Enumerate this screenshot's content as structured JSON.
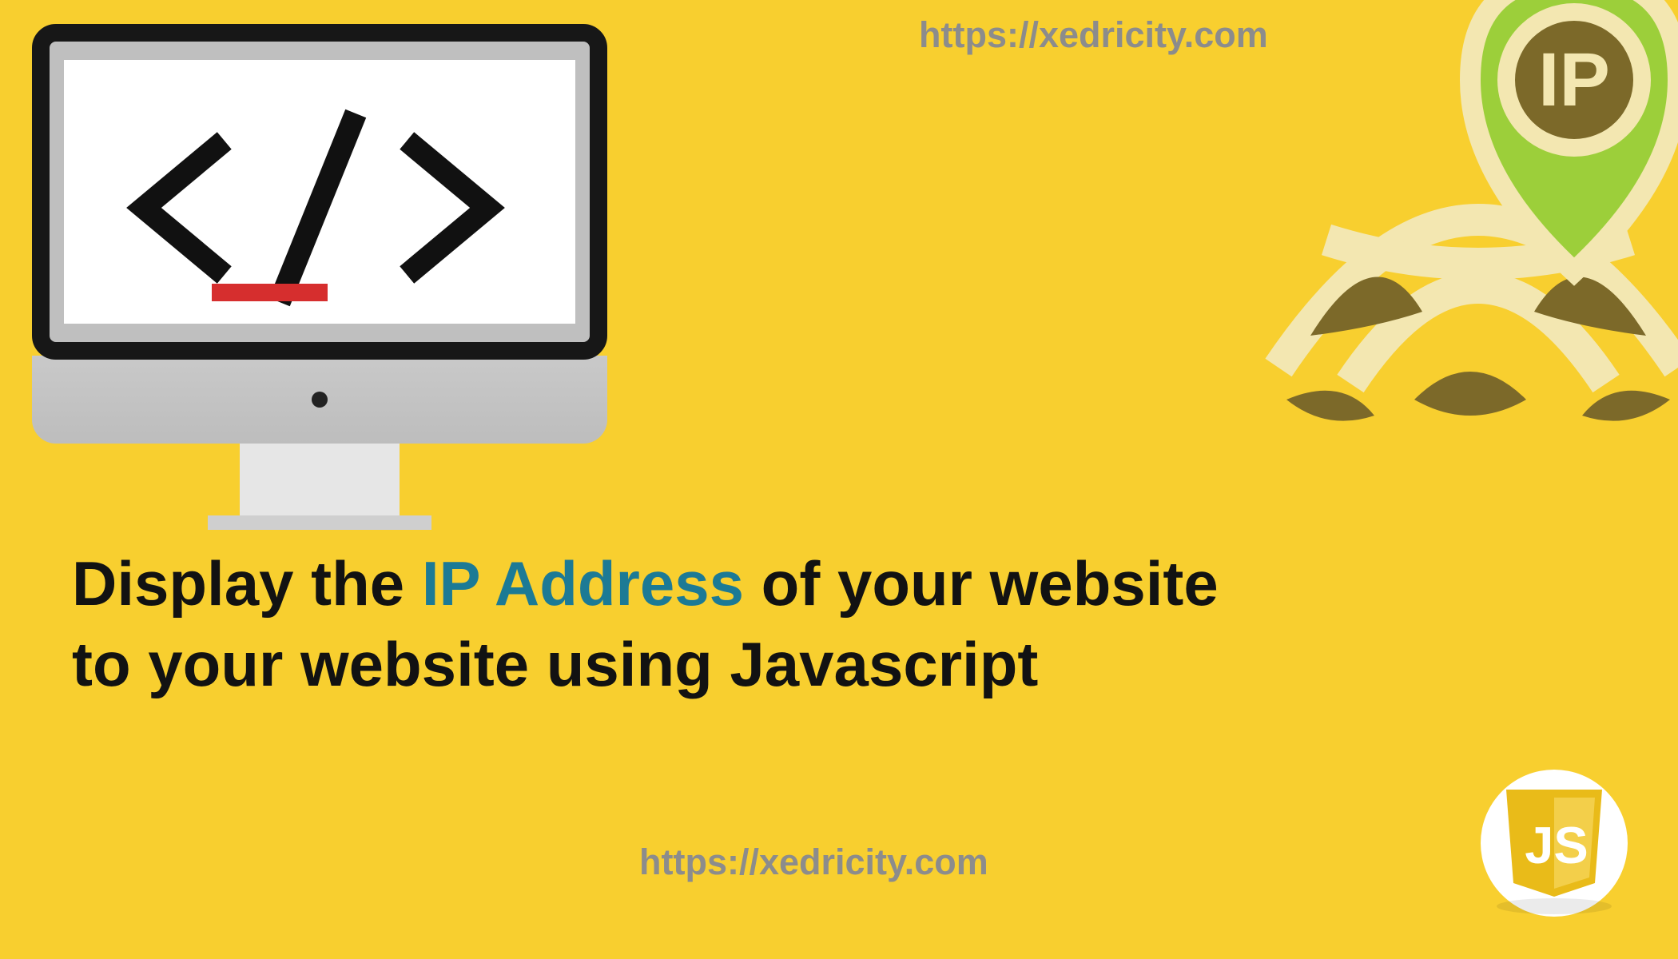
{
  "top_url": "https://xedricity.com",
  "bottom_url": "https://xedricity.com",
  "headline": {
    "part1": "Display the ",
    "highlight": "IP Address",
    "part2": " of your website",
    "line2": "to your website using Javascript"
  },
  "icons": {
    "ip_label": "IP",
    "js_label": "JS"
  },
  "colors": {
    "background": "#f8cf2f",
    "accent_text": "#1c7a95",
    "url_grey": "#8c8c8c",
    "globe_olive": "#7c6929",
    "globe_cream": "#f3e7b1",
    "pin_green": "#9ccf3a",
    "js_yellow": "#e9bb19"
  }
}
